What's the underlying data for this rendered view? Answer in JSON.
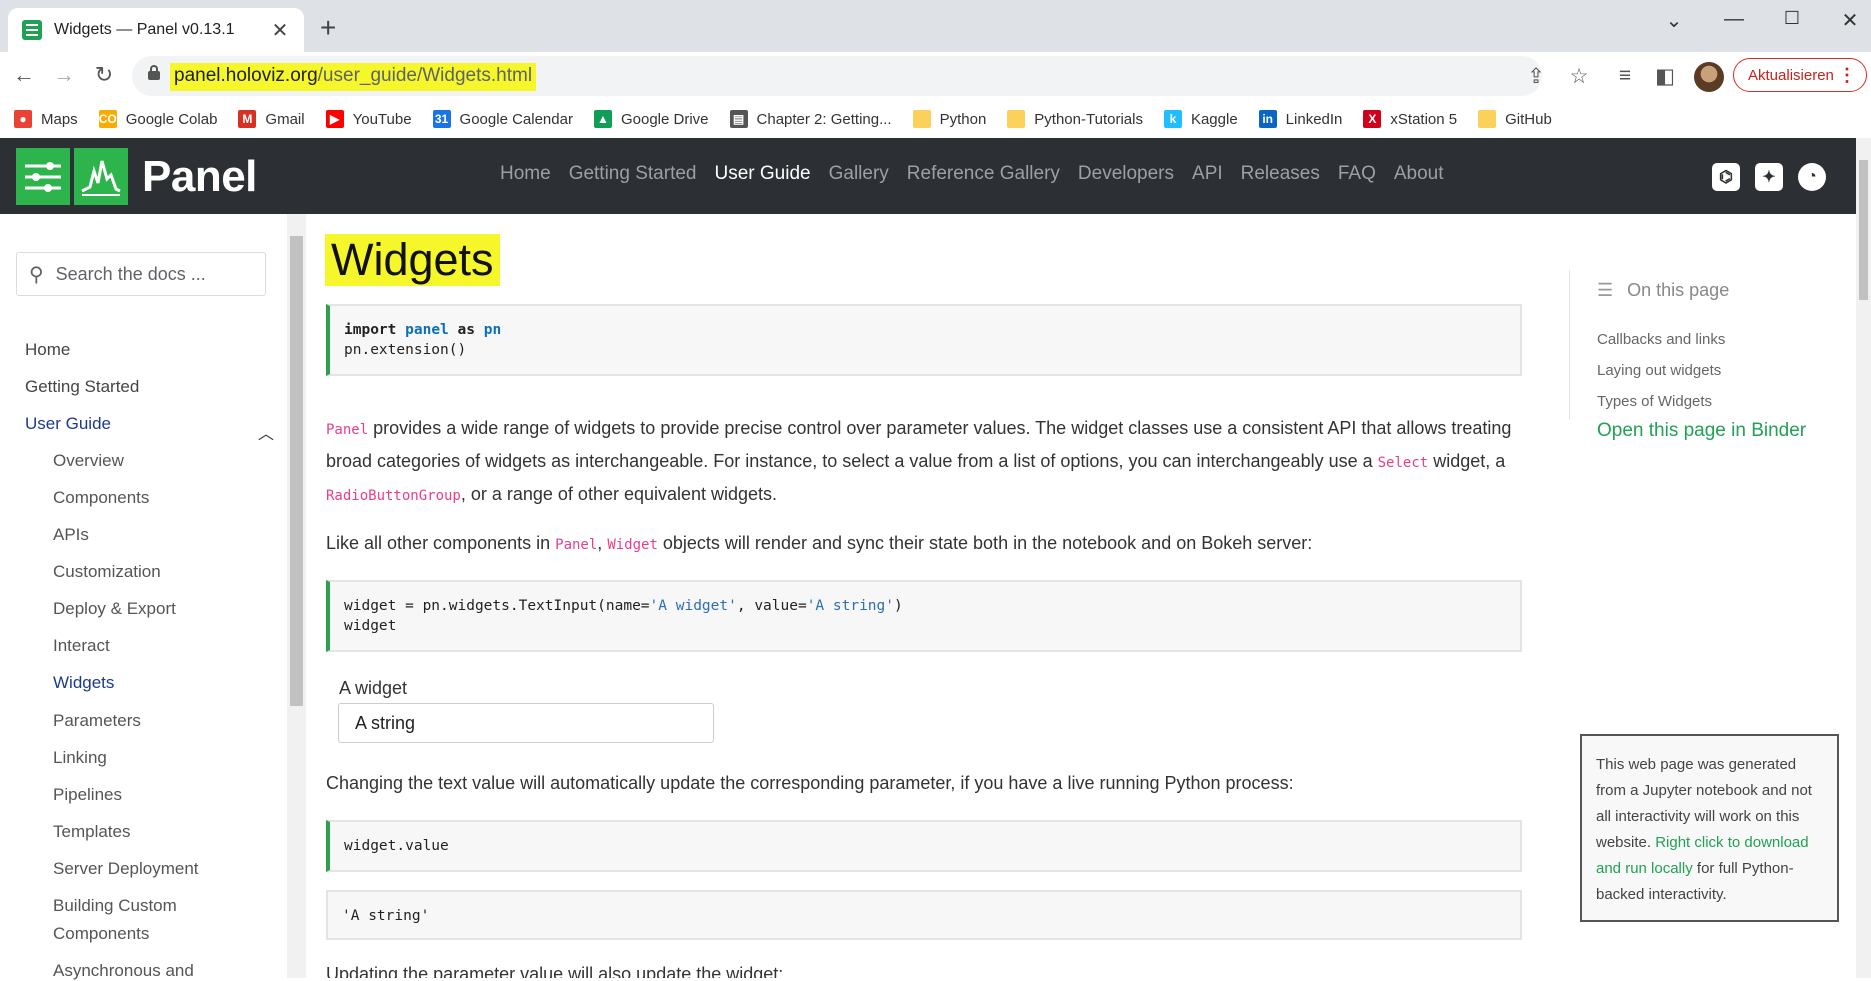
{
  "browser": {
    "tab_title": "Widgets — Panel v0.13.1",
    "tab_close": "✕",
    "new_tab": "+",
    "url_host": "panel.holoviz.org",
    "url_path": "/user_guide/Widgets.html",
    "update_label": "Aktualisieren",
    "bookmarks": [
      {
        "label": "Maps",
        "icon": "maps-pin-icon",
        "color": "#ea4335"
      },
      {
        "label": "Google Colab",
        "icon": "colab-icon",
        "color": "#f9ab00"
      },
      {
        "label": "Gmail",
        "icon": "gmail-icon",
        "color": "#d93025"
      },
      {
        "label": "YouTube",
        "icon": "youtube-icon",
        "color": "#ff0000"
      },
      {
        "label": "Google Calendar",
        "icon": "calendar-icon",
        "color": "#1a73e8"
      },
      {
        "label": "Google Drive",
        "icon": "drive-icon",
        "color": "#0f9d58"
      },
      {
        "label": "Chapter 2: Getting...",
        "icon": "book-icon",
        "color": "#555555"
      },
      {
        "label": "Python",
        "icon": "folder-icon",
        "color": "#fbd15b"
      },
      {
        "label": "Python-Tutorials",
        "icon": "folder-icon",
        "color": "#fbd15b"
      },
      {
        "label": "Kaggle",
        "icon": "kaggle-icon",
        "color": "#20beff"
      },
      {
        "label": "LinkedIn",
        "icon": "linkedin-icon",
        "color": "#0a66c2"
      },
      {
        "label": "xStation 5",
        "icon": "xstation-icon",
        "color": "#d0021b"
      },
      {
        "label": "GitHub",
        "icon": "folder-icon",
        "color": "#fbd15b"
      }
    ]
  },
  "header": {
    "logo_text": "Panel",
    "nav": [
      "Home",
      "Getting Started",
      "User Guide",
      "Gallery",
      "Reference Gallery",
      "Developers",
      "API",
      "Releases",
      "FAQ",
      "About"
    ],
    "active_nav": "User Guide"
  },
  "sidebar": {
    "search_placeholder": "Search the docs ...",
    "top_items": [
      "Home",
      "Getting Started",
      "User Guide"
    ],
    "sub_items": [
      "Overview",
      "Components",
      "APIs",
      "Customization",
      "Deploy & Export",
      "Interact",
      "Widgets",
      "Parameters",
      "Linking",
      "Pipelines",
      "Templates",
      "Server Deployment",
      "Building Custom",
      "Components",
      "Asynchronous and"
    ],
    "active_item": "Widgets"
  },
  "main": {
    "title": "Widgets",
    "code1_line1_kw1": "import",
    "code1_line1_mod": "panel",
    "code1_line1_kw2": "as",
    "code1_line1_alias": "pn",
    "code1_line2": "pn.extension()",
    "p1_code1": "Panel",
    "p1_text1": " provides a wide range of widgets to provide precise control over parameter values. The widget classes use a consistent API that allows treating broad categories of widgets as interchangeable. For instance, to select a value from a list of options, you can interchangeably use a ",
    "p1_code2": "Select",
    "p1_text2": " widget, a ",
    "p1_code3": "RadioButtonGroup",
    "p1_text3": ", or a range of other equivalent widgets.",
    "p2_text1": "Like all other components in ",
    "p2_code1": "Panel",
    "p2_sep": ", ",
    "p2_code2": "Widget",
    "p2_text2": " objects will render and sync their state both in the notebook and on Bokeh server:",
    "code2_pre": "widget = pn.widgets.TextInput(name=",
    "code2_str1": "'A widget'",
    "code2_mid": ", value=",
    "code2_str2": "'A string'",
    "code2_post": ")",
    "code2_line2": "widget",
    "widget_label": "A widget",
    "widget_value": "A string",
    "p3": "Changing the text value will automatically update the corresponding parameter, if you have a live running Python process:",
    "code3": "widget.value",
    "out3": "'A string'",
    "p4": "Updating the parameter value will also update the widget:"
  },
  "toc": {
    "heading": "On this page",
    "items": [
      "Callbacks and links",
      "Laying out widgets",
      "Types of Widgets"
    ],
    "binder": "Open this page in Binder"
  },
  "note": {
    "text1": "This web page was generated from a Jupyter notebook and not all interactivity will work on this website. ",
    "link": "Right click to download and run locally",
    "text2": " for full Python-backed interactivity."
  },
  "colors": {
    "header_bg": "#2c2f33",
    "panel_green": "#2eb44c",
    "highlight": "#f6f72a",
    "accent_blue": "#1e3a8a",
    "code_border": "#2e9e4f"
  }
}
